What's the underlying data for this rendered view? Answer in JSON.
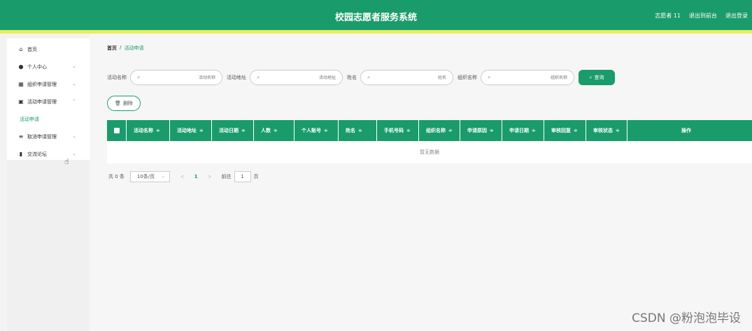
{
  "header": {
    "title": "校园志愿者服务系统",
    "user": "志愿者 11",
    "back_to_front": "退出到前台",
    "logout": "退出登录"
  },
  "sidebar": {
    "items": [
      {
        "label": "首页",
        "icon": "home-icon"
      },
      {
        "label": "个人中心",
        "icon": "person-icon"
      },
      {
        "label": "组织申请管理",
        "icon": "grid-icon"
      },
      {
        "label": "活动申请管理",
        "icon": "clipboard-icon"
      },
      {
        "label": "取消申请管理",
        "icon": "list-icon"
      },
      {
        "label": "交流论坛",
        "icon": "bar-chart-icon"
      }
    ],
    "sub_item": "活动申请"
  },
  "breadcrumb": {
    "home": "首页",
    "separator": "/",
    "current": "活动申请"
  },
  "search": {
    "fields": [
      {
        "label": "活动名称",
        "placeholder": "活动名称"
      },
      {
        "label": "活动地址",
        "placeholder": "活动地址"
      },
      {
        "label": "姓名",
        "placeholder": "姓名"
      },
      {
        "label": "组织名称",
        "placeholder": "组织名称"
      }
    ],
    "button": "查询"
  },
  "delete_button": "删除",
  "table": {
    "columns": [
      "活动名称",
      "活动地址",
      "活动日期",
      "人数",
      "个人账号",
      "姓名",
      "手机号码",
      "组织名称",
      "申请原因",
      "申请日期",
      "审核回复",
      "审核状态"
    ],
    "sort_mark": "≑",
    "op_column": "操作",
    "empty_text": "暂无数据"
  },
  "pagination": {
    "total": "共 0 条",
    "page_size": "10条/页",
    "prev": "<",
    "current_page": "1",
    "next": ">",
    "goto_label": "前往",
    "goto_value": "1",
    "page_unit": "页"
  },
  "watermark": "CSDN @粉泡泡毕设"
}
